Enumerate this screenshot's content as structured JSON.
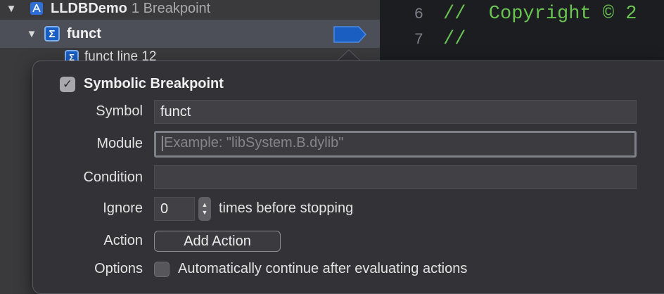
{
  "navigator": {
    "project": {
      "name": "LLDBDemo",
      "count": "1 Breakpoint"
    },
    "breakpoint": {
      "name": "funct",
      "icon": "symbol-sigma-icon",
      "glyph": "Σ"
    },
    "child": {
      "name": "funct line 12"
    }
  },
  "editor": {
    "lines": [
      {
        "number": "6",
        "text": "//  Copyright © 2"
      },
      {
        "number": "7",
        "text": "//"
      }
    ]
  },
  "popover": {
    "title": "Symbolic Breakpoint",
    "title_checked": true,
    "symbol": {
      "label": "Symbol",
      "value": "funct"
    },
    "module": {
      "label": "Module",
      "value": "",
      "placeholder": "Example: \"libSystem.B.dylib\""
    },
    "condition": {
      "label": "Condition",
      "value": ""
    },
    "ignore": {
      "label": "Ignore",
      "value": "0",
      "suffix": "times before stopping"
    },
    "action": {
      "label": "Action",
      "button": "Add Action"
    },
    "options": {
      "label": "Options",
      "checkbox_label": "Automatically continue after evaluating actions",
      "checked": false
    }
  },
  "colors": {
    "accent": "#1a5ec2",
    "comment": "#69c452"
  }
}
